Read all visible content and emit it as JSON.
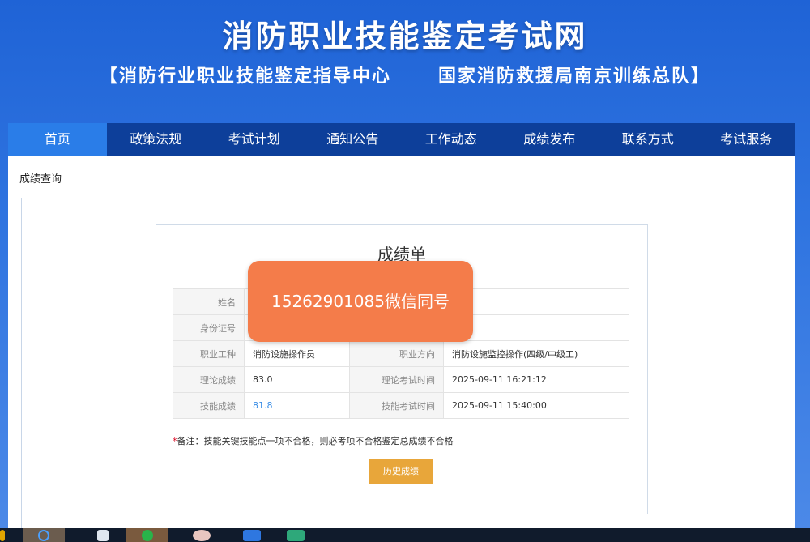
{
  "header": {
    "title": "消防职业技能鉴定考试网",
    "subtitle": "【消防行业职业技能鉴定指导中心      国家消防救援局南京训练总队】"
  },
  "nav": {
    "items": [
      "首页",
      "政策法规",
      "考试计划",
      "通知公告",
      "工作动态",
      "成绩发布",
      "联系方式",
      "考试服务"
    ]
  },
  "breadcrumb": "成绩查询",
  "report": {
    "title": "成绩单",
    "rows": [
      {
        "label": "姓名",
        "value": ""
      },
      {
        "label": "身份证号",
        "value": ""
      },
      {
        "label": "职业工种",
        "value": "消防设施操作员",
        "label2": "职业方向",
        "value2": "消防设施监控操作(四级/中级工)"
      },
      {
        "label": "理论成绩",
        "value": "83.0",
        "label2": "理论考试时间",
        "value2": "2025-09-11 16:21:12"
      },
      {
        "label": "技能成绩",
        "value": "81.8",
        "label2": "技能考试时间",
        "value2": "2025-09-11 15:40:00"
      }
    ],
    "note_star": "*",
    "note": "备注：技能关键技能点一项不合格，则必考项不合格鉴定总成绩不合格",
    "history_button": "历史成绩"
  },
  "overlay_text": "15262901085微信同号",
  "colors": {
    "nav_bg": "#0d3f9a",
    "nav_active": "#2a7de8",
    "button": "#e8a63a",
    "overlay": "#f47c4a",
    "link": "#3a8ee6"
  }
}
